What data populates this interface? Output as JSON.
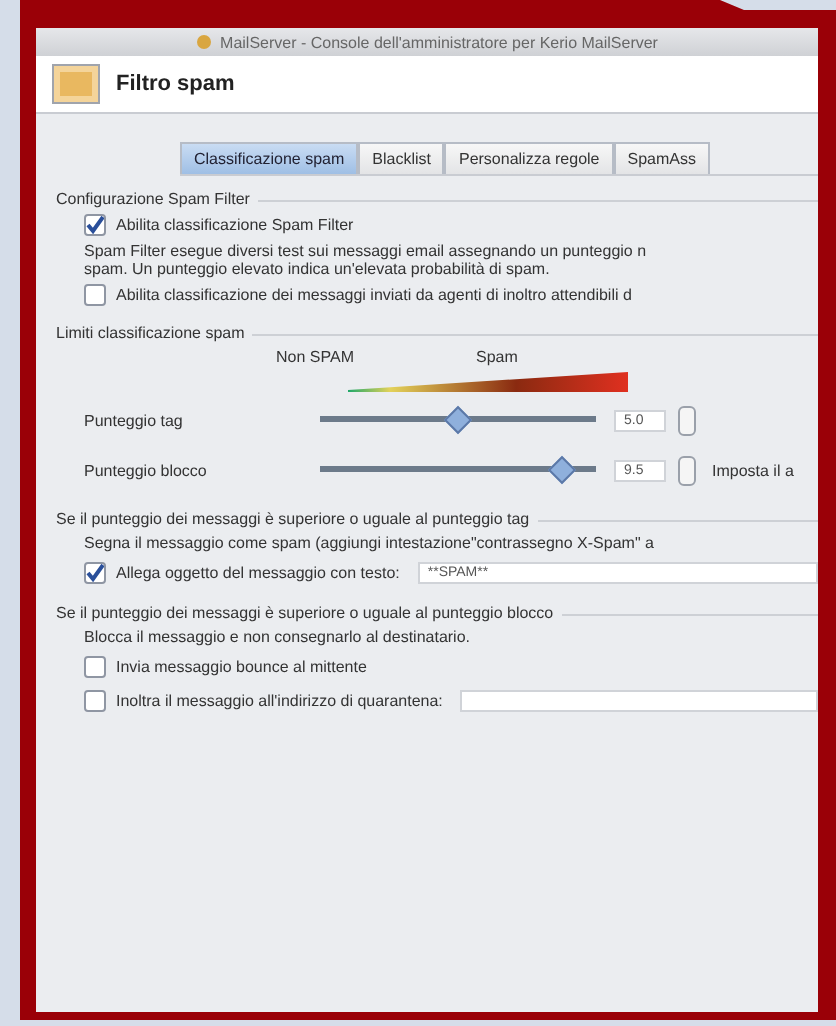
{
  "window": {
    "title": "MailServer - Console dell'amministratore per Kerio MailServer"
  },
  "header": {
    "title": "Filtro spam"
  },
  "tabs": [
    {
      "label": "Classificazione spam",
      "selected": true
    },
    {
      "label": "Blacklist",
      "selected": false
    },
    {
      "label": "Personalizza regole",
      "selected": false
    },
    {
      "label": "SpamAss",
      "selected": false
    }
  ],
  "config": {
    "title": "Configurazione Spam Filter",
    "enable": {
      "label": "Abilita classificazione Spam Filter",
      "checked": true
    },
    "description": [
      "Spam Filter esegue diversi test sui messaggi email assegnando un punteggio n",
      "spam. Un punteggio elevato indica un'elevata probabilità di spam."
    ],
    "trusted": {
      "label": "Abilita classificazione dei messaggi inviati da agenti di inoltro attendibili d",
      "checked": false
    }
  },
  "limits": {
    "title": "Limiti classificazione spam",
    "scale_left": "Non SPAM",
    "scale_right": "Spam",
    "sliders": [
      {
        "label": "Punteggio tag",
        "level": 0.5,
        "value": "5.0"
      },
      {
        "label": "Punteggio blocco",
        "level": 0.92,
        "value": "9.5",
        "note": "Imposta il a"
      }
    ]
  },
  "tag_section": {
    "title": "Se il punteggio dei messaggi è superiore o uguale al punteggio tag",
    "text": "Segna il messaggio come spam (aggiungi intestazione\"contrassegno X-Spam\" a",
    "options": [
      {
        "label": "Allega oggetto del messaggio con testo:",
        "checked": true,
        "value": "**SPAM**"
      }
    ]
  },
  "block_section": {
    "title": "Se il punteggio dei messaggi è superiore o uguale al punteggio blocco",
    "text": "Blocca il messaggio e non consegnarlo al destinatario.",
    "options": [
      {
        "label": "Invia messaggio bounce al mittente",
        "checked": false
      },
      {
        "label": "Inoltra il messaggio all'indirizzo di quarantena:",
        "checked": false,
        "field": true
      }
    ]
  }
}
